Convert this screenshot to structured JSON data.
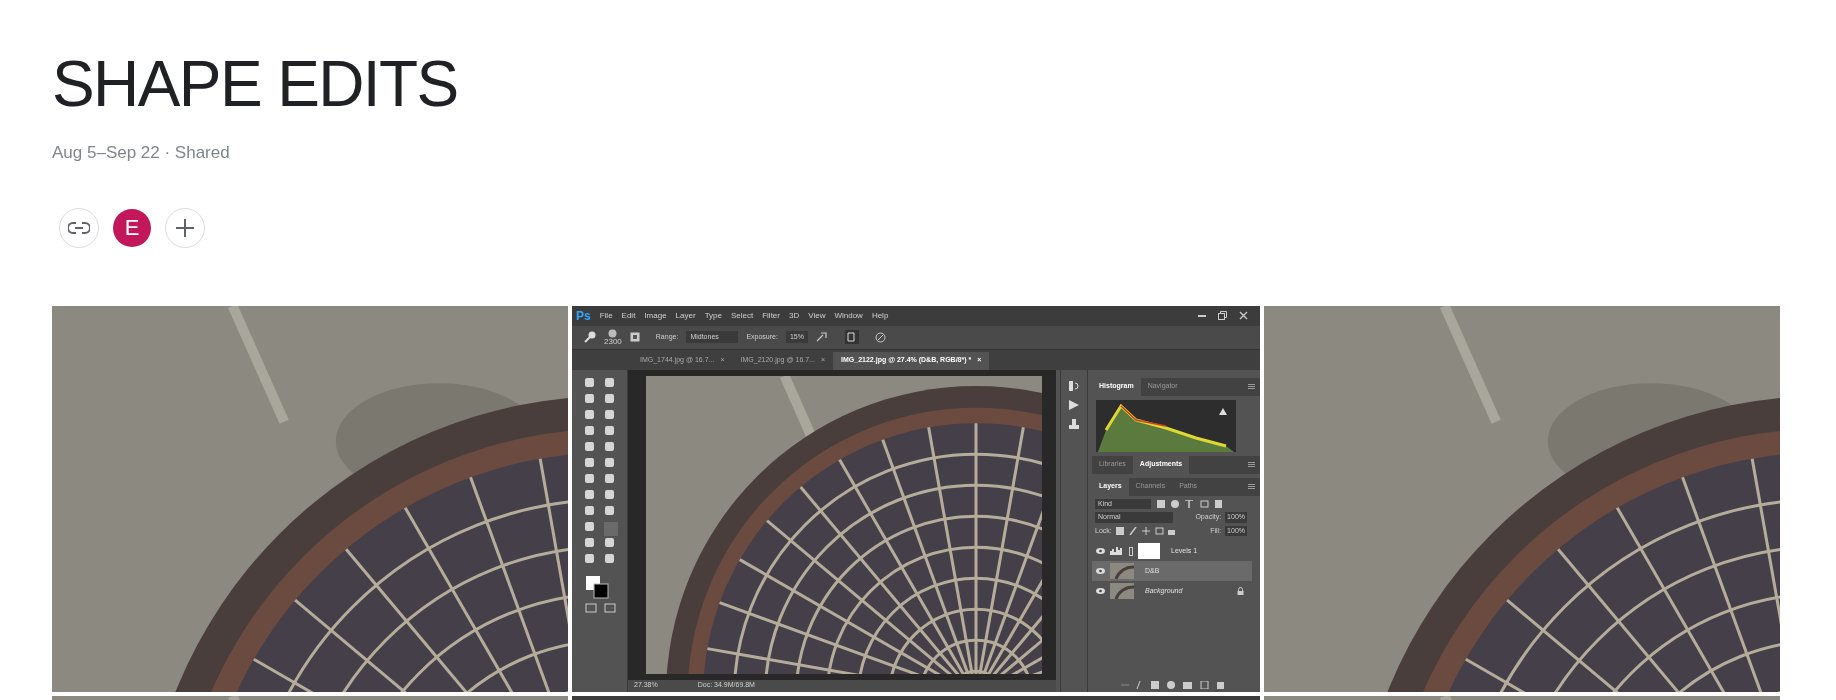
{
  "album": {
    "title": "SHAPE EDITS",
    "subtitle": "Aug 5–Sep 22 · Shared",
    "avatar": {
      "initial": "E",
      "color": "#c2185b"
    }
  },
  "photo_rows": [
    [
      {
        "kind": "photo"
      },
      {
        "kind": "screenshot"
      },
      {
        "kind": "photo"
      }
    ],
    [
      {
        "kind": "photo"
      },
      {
        "kind": "dark"
      },
      {
        "kind": "photo"
      }
    ]
  ],
  "screenshot": {
    "app_logo": "Ps",
    "menu": [
      "File",
      "Edit",
      "Image",
      "Layer",
      "Type",
      "Select",
      "Filter",
      "3D",
      "View",
      "Window",
      "Help"
    ],
    "options": {
      "brush_size": "2300",
      "range_label": "Range:",
      "range": "Midtones",
      "exposure_label": "Exposure:",
      "exposure": "15%"
    },
    "tabs": [
      {
        "label": "IMG_1744.jpg @ 16.7...",
        "close": "×",
        "selected": false
      },
      {
        "label": "IMG_2120.jpg @ 16.7...",
        "close": "×",
        "selected": false
      },
      {
        "label": "IMG_2122.jpg @ 27.4% (D&B, RGB/8*) *",
        "close": "×",
        "selected": true
      }
    ],
    "panel_groups": [
      [
        {
          "label": "Histogram",
          "selected": true
        },
        {
          "label": "Navigator",
          "selected": false
        }
      ],
      [
        {
          "label": "Libraries",
          "selected": false
        },
        {
          "label": "Adjustments",
          "selected": true
        }
      ],
      [
        {
          "label": "Layers",
          "selected": true
        },
        {
          "label": "Channels",
          "selected": false
        },
        {
          "label": "Paths",
          "selected": false
        }
      ]
    ],
    "layers_panel": {
      "filter": "Kind",
      "blend_mode": "Normal",
      "opacity_label": "Opacity:",
      "opacity": "100%",
      "lock_label": "Lock:",
      "fill_label": "Fill:",
      "fill": "100%",
      "layers": [
        {
          "kind": "adjustment",
          "name": "Levels 1",
          "visible": true,
          "selected": false,
          "locked": false
        },
        {
          "kind": "image",
          "name": "D&B",
          "visible": true,
          "selected": true,
          "locked": false
        },
        {
          "kind": "background",
          "name": "Background",
          "visible": true,
          "selected": false,
          "locked": true
        }
      ]
    },
    "status": {
      "zoom": "27.38%",
      "doc": "Doc: 34.9M/69.8M"
    }
  }
}
